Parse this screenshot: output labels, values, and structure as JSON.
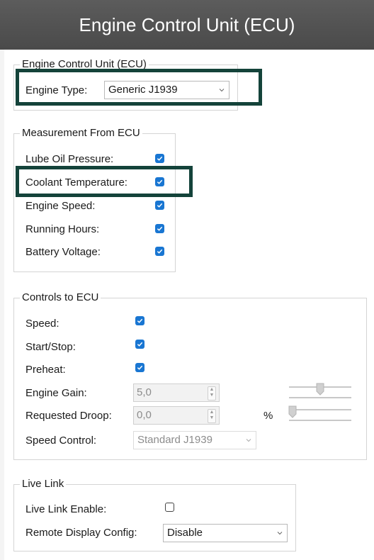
{
  "window": {
    "title": "Engine Control Unit (ECU)"
  },
  "ecu_group": {
    "legend": "Engine Control Unit (ECU)",
    "engine_type_label": "Engine Type:",
    "engine_type_value": "Generic J1939"
  },
  "measurement_group": {
    "legend": "Measurement From ECU",
    "items": [
      {
        "label": "Lube Oil Pressure:",
        "checked": true
      },
      {
        "label": "Coolant Temperature:",
        "checked": true
      },
      {
        "label": "Engine Speed:",
        "checked": true
      },
      {
        "label": "Running Hours:",
        "checked": true
      },
      {
        "label": "Battery Voltage:",
        "checked": true
      }
    ]
  },
  "controls_group": {
    "legend": "Controls to ECU",
    "speed_label": "Speed:",
    "speed_checked": true,
    "startstop_label": "Start/Stop:",
    "startstop_checked": true,
    "preheat_label": "Preheat:",
    "preheat_checked": true,
    "engine_gain_label": "Engine Gain:",
    "engine_gain_value": "5,0",
    "requested_droop_label": "Requested Droop:",
    "requested_droop_value": "0,0",
    "droop_unit": "%",
    "speed_control_label": "Speed Control:",
    "speed_control_value": "Standard J1939"
  },
  "livelink_group": {
    "legend": "Live Link",
    "enable_label": "Live Link Enable:",
    "enable_checked": false,
    "remote_label": "Remote Display Config:",
    "remote_value": "Disable"
  },
  "colors": {
    "titlebar": "#4f4f4f",
    "checkbox_accent": "#1976d2",
    "highlight_border": "#14433a"
  },
  "icons": [
    "chevron-down-icon",
    "check-icon",
    "spin-up-icon",
    "spin-down-icon"
  ]
}
